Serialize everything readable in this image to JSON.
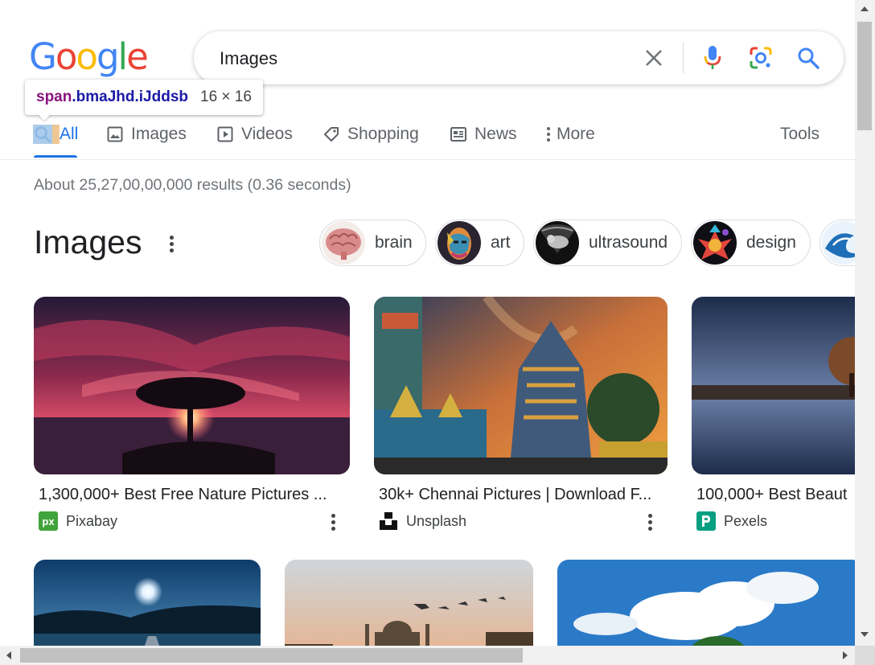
{
  "search": {
    "query": "Images",
    "placeholder": ""
  },
  "logo": [
    "G",
    "o",
    "o",
    "g",
    "l",
    "e"
  ],
  "logo_colors": [
    "#4285f4",
    "#ea4335",
    "#fbbc05",
    "#4285f4",
    "#34a853",
    "#ea4335"
  ],
  "tooltip": {
    "selector_tag": "span",
    "selector_classes": ".bmaJhd.iJddsb",
    "dimensions": "16 × 16"
  },
  "tabs": {
    "all": "All",
    "images": "Images",
    "videos": "Videos",
    "shopping": "Shopping",
    "news": "News",
    "more": "More",
    "tools": "Tools"
  },
  "result_stats": "About 25,27,00,00,000 results (0.36 seconds)",
  "images_section": {
    "heading": "Images",
    "chips": [
      "brain",
      "art",
      "ultrasound",
      "design"
    ],
    "cards": [
      {
        "title": "1,300,000+ Best Free Nature Pictures ...",
        "source": "Pixabay"
      },
      {
        "title": "30k+ Chennai Pictures | Download F...",
        "source": "Unsplash"
      },
      {
        "title": "100,000+ Best Beaut",
        "source": "Pexels"
      }
    ]
  },
  "colors": {
    "accent": "#1a73e8",
    "tooltip_tag": "#881280",
    "tooltip_class": "#1a1aa6"
  }
}
